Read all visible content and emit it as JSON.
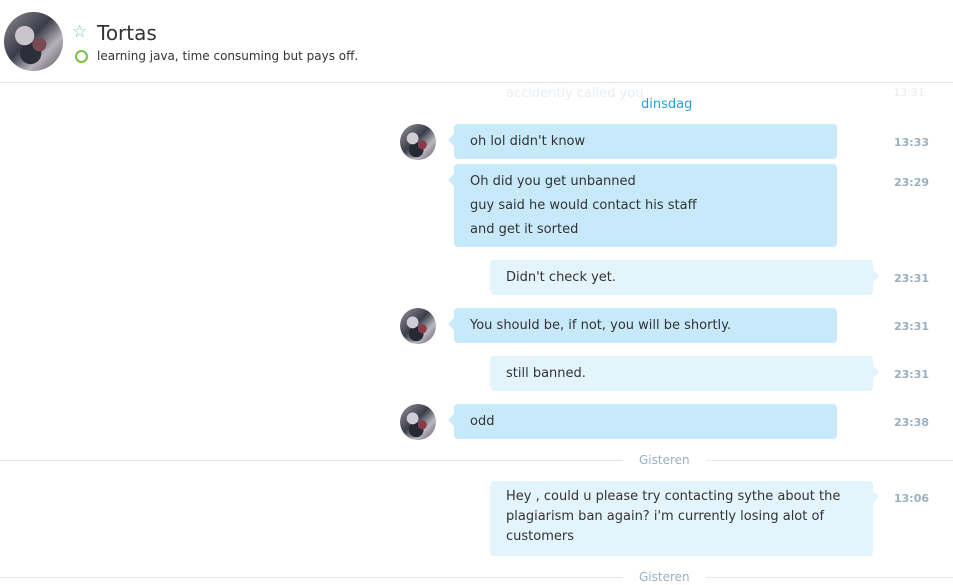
{
  "contact": {
    "name": "Tortas",
    "mood": "learning java, time consuming but pays off."
  },
  "colors": {
    "accent": "#2aa0d6",
    "incoming_bubble": "#c7e9f9",
    "outgoing_bubble": "#e4f4fc",
    "presence_online": "#7cc23b"
  },
  "history": {
    "faded_message": "accidently called you",
    "faded_time": "13:31"
  },
  "day_labels": {
    "top": "dinsdag",
    "yesterday_1": "Gisteren",
    "yesterday_2": "Gisteren"
  },
  "messages": [
    {
      "direction": "in",
      "lines": [
        "oh lol didn't know"
      ],
      "time": "13:33"
    },
    {
      "direction": "in",
      "lines": [
        "Oh did you get unbanned",
        "guy said he would contact his staff",
        "and get it sorted"
      ],
      "time": "23:29"
    },
    {
      "direction": "out",
      "lines": [
        "Didn't check yet."
      ],
      "time": "23:31"
    },
    {
      "direction": "in",
      "lines": [
        "You should be, if not, you will be shortly."
      ],
      "time": "23:31"
    },
    {
      "direction": "out",
      "lines": [
        "still banned."
      ],
      "time": "23:31"
    },
    {
      "direction": "in",
      "lines": [
        "odd"
      ],
      "time": "23:38"
    },
    {
      "direction": "out",
      "lines": [
        "Hey , could u please try contacting sythe about the",
        "plagiarism ban again?  i'm currently losing alot of",
        "customers"
      ],
      "time": "13:06"
    }
  ]
}
